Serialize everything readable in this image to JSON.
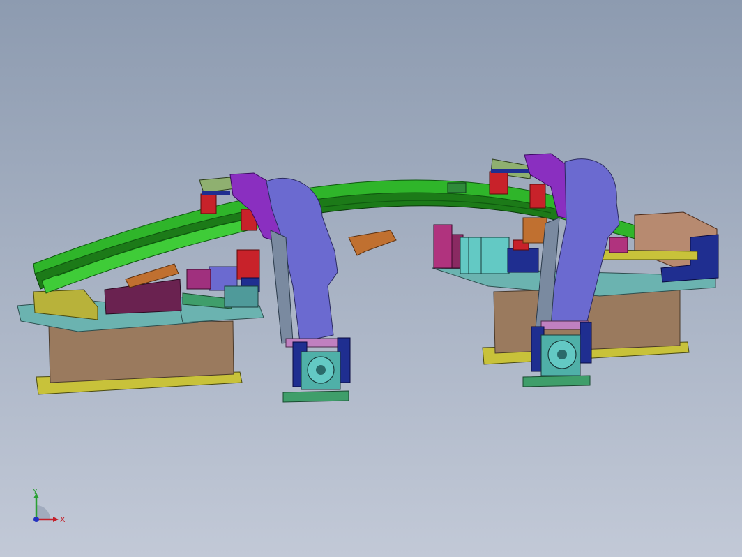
{
  "view": {
    "background_top": "#8d9bb0",
    "background_bottom": "#c2c9d7"
  },
  "model": {
    "colors": {
      "rail_green": "#2fb52a",
      "rail_dark": "#1c7a18",
      "base_brown": "#9a7a5e",
      "base_plate_yellow": "#c8c23a",
      "plate_teal": "#6bb3b0",
      "clamp_violet": "#6b6ad0",
      "clamp_purple": "#8a2fc0",
      "block_red": "#c8222a",
      "block_navy": "#1f2e90",
      "block_magenta": "#b0337e",
      "cylinder_cyan": "#63c9c4",
      "base_mint": "#3f9e6a"
    }
  },
  "triad": {
    "x_label": "X",
    "y_label": "Y",
    "x_color": "#c3202a",
    "y_color": "#2aa033",
    "z_color": "#2433c0"
  }
}
